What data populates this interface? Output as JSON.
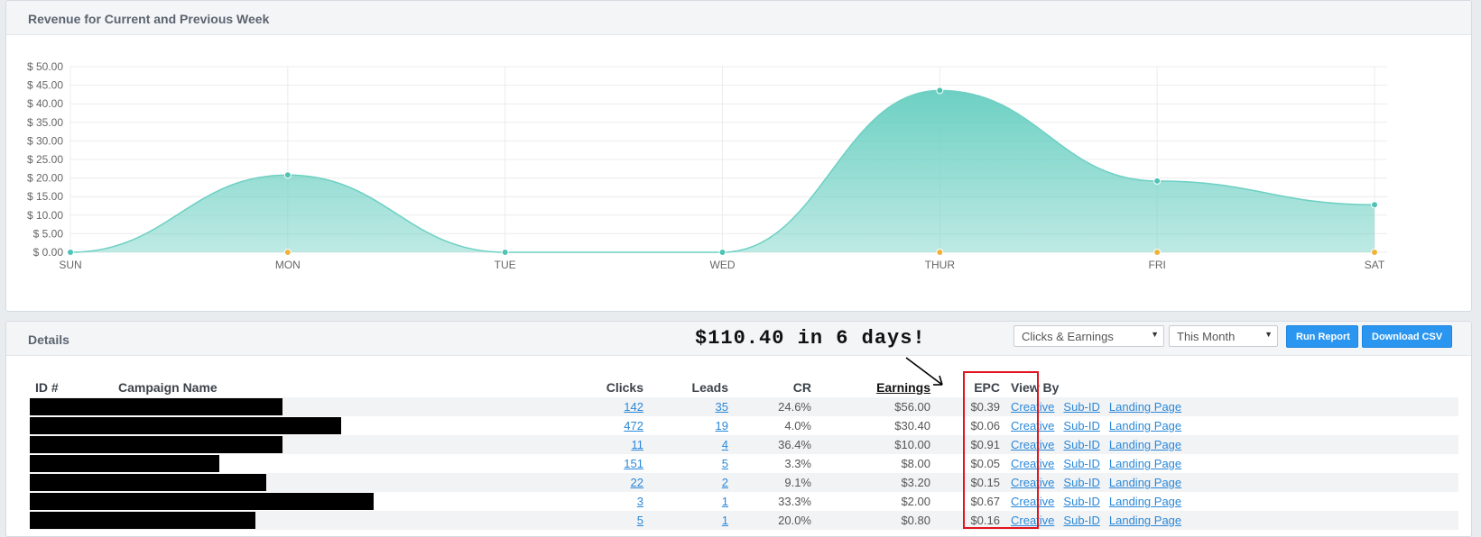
{
  "revenue_panel": {
    "title": "Revenue for Current and Previous Week"
  },
  "chart_data": {
    "type": "area",
    "categories": [
      "SUN",
      "MON",
      "TUE",
      "WED",
      "THUR",
      "FRI",
      "SAT"
    ],
    "y_ticks": [
      "$ 0.00",
      "$ 5.00",
      "$ 10.00",
      "$ 15.00",
      "$ 20.00",
      "$ 25.00",
      "$ 30.00",
      "$ 35.00",
      "$ 40.00",
      "$ 45.00",
      "$ 50.00"
    ],
    "ylim": [
      0,
      50
    ],
    "grid": true,
    "series": [
      {
        "values": [
          0,
          20.8,
          0,
          0,
          43.6,
          19.2,
          12.8
        ],
        "color": "#6dd0c3",
        "marker": "#4fc3b4"
      },
      {
        "values": [
          null,
          0,
          null,
          null,
          0,
          0,
          0
        ],
        "color": "#f0b23a",
        "marker": "#f0b23a"
      }
    ]
  },
  "details": {
    "title": "Details",
    "callout": "$110.40 in 6 days!",
    "select_metric": "Clicks & Earnings",
    "select_period": "This Month",
    "run_button": "Run Report",
    "csv_button": "Download CSV",
    "columns": {
      "id": "ID #",
      "name": "Campaign Name",
      "clicks": "Clicks",
      "leads": "Leads",
      "cr": "CR",
      "earnings": "Earnings",
      "epc": "EPC",
      "view_by": "View By"
    },
    "view_links": [
      "Creative",
      "Sub-ID",
      "Landing Page"
    ],
    "rows": [
      {
        "clicks": "142",
        "leads": "35",
        "cr": "24.6%",
        "earnings": "$56.00",
        "epc": "$0.39"
      },
      {
        "clicks": "472",
        "leads": "19",
        "cr": "4.0%",
        "earnings": "$30.40",
        "epc": "$0.06"
      },
      {
        "clicks": "11",
        "leads": "4",
        "cr": "36.4%",
        "earnings": "$10.00",
        "epc": "$0.91"
      },
      {
        "clicks": "151",
        "leads": "5",
        "cr": "3.3%",
        "earnings": "$8.00",
        "epc": "$0.05"
      },
      {
        "clicks": "22",
        "leads": "2",
        "cr": "9.1%",
        "earnings": "$3.20",
        "epc": "$0.15"
      },
      {
        "clicks": "3",
        "leads": "1",
        "cr": "33.3%",
        "earnings": "$2.00",
        "epc": "$0.67"
      },
      {
        "clicks": "5",
        "leads": "1",
        "cr": "20.0%",
        "earnings": "$0.80",
        "epc": "$0.16"
      }
    ]
  }
}
